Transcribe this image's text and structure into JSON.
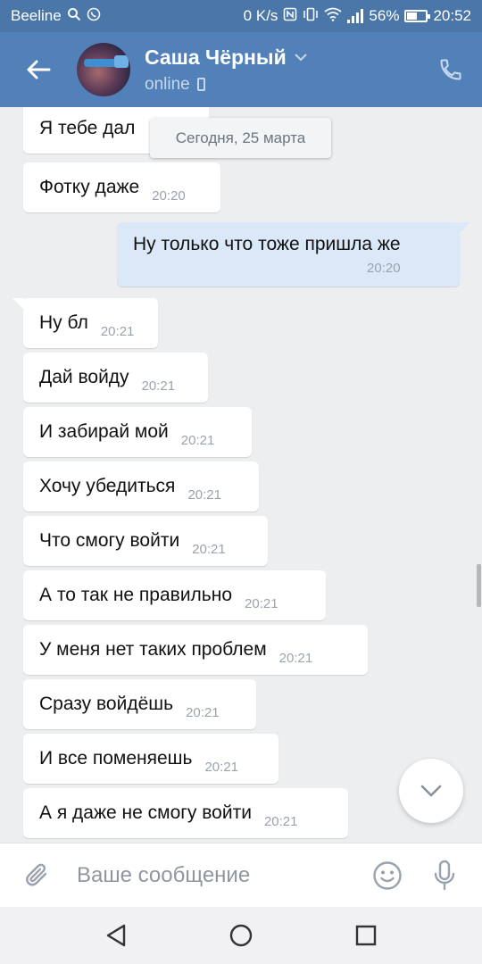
{
  "status_bar": {
    "carrier": "Beeline",
    "speed": "0 K/s",
    "battery": "56%",
    "battery_level": 0.56,
    "time": "20:52",
    "icons": [
      "search-icon",
      "whatsapp-icon",
      "nfc-icon",
      "vibrate-icon",
      "wifi-icon",
      "signal-icon",
      "battery-icon"
    ]
  },
  "header": {
    "name": "Саша Чёрный",
    "status": "online",
    "icons": [
      "back-arrow-icon",
      "chevron-down-icon",
      "mobile-icon",
      "phone-icon"
    ]
  },
  "date_separator": "Сегодня, 25 марта",
  "messages": [
    {
      "text": "Я тебе дал",
      "time": "",
      "direction": "in"
    },
    {
      "text": "Фотку даже",
      "time": "20:20",
      "direction": "in"
    },
    {
      "text": "Ну только что тоже пришла же",
      "time": "20:20",
      "direction": "out"
    },
    {
      "text": "Ну бл",
      "time": "20:21",
      "direction": "in"
    },
    {
      "text": "Дай войду",
      "time": "20:21",
      "direction": "in"
    },
    {
      "text": "И забирай мой",
      "time": "20:21",
      "direction": "in"
    },
    {
      "text": "Хочу убедиться",
      "time": "20:21",
      "direction": "in"
    },
    {
      "text": "Что смогу войти",
      "time": "20:21",
      "direction": "in"
    },
    {
      "text": "А то так не правильно",
      "time": "20:21",
      "direction": "in"
    },
    {
      "text": "У меня нет таких проблем",
      "time": "20:21",
      "direction": "in"
    },
    {
      "text": "Сразу войдёшь",
      "time": "20:21",
      "direction": "in"
    },
    {
      "text": "И все поменяешь",
      "time": "20:21",
      "direction": "in"
    },
    {
      "text": "А я даже не смогу войти",
      "time": "20:21",
      "direction": "in"
    }
  ],
  "composer": {
    "placeholder": "Ваше сообщение",
    "icons": [
      "paperclip-icon",
      "smiley-icon",
      "microphone-icon"
    ]
  },
  "navigation": {
    "icons": [
      "back-triangle-icon",
      "home-circle-icon",
      "recents-square-icon"
    ]
  },
  "colors": {
    "status_bar": "#4a76a8",
    "header": "#5181b8",
    "background": "#edeef0",
    "incoming_bubble": "#ffffff",
    "outgoing_bubble": "#dbe8f7"
  }
}
